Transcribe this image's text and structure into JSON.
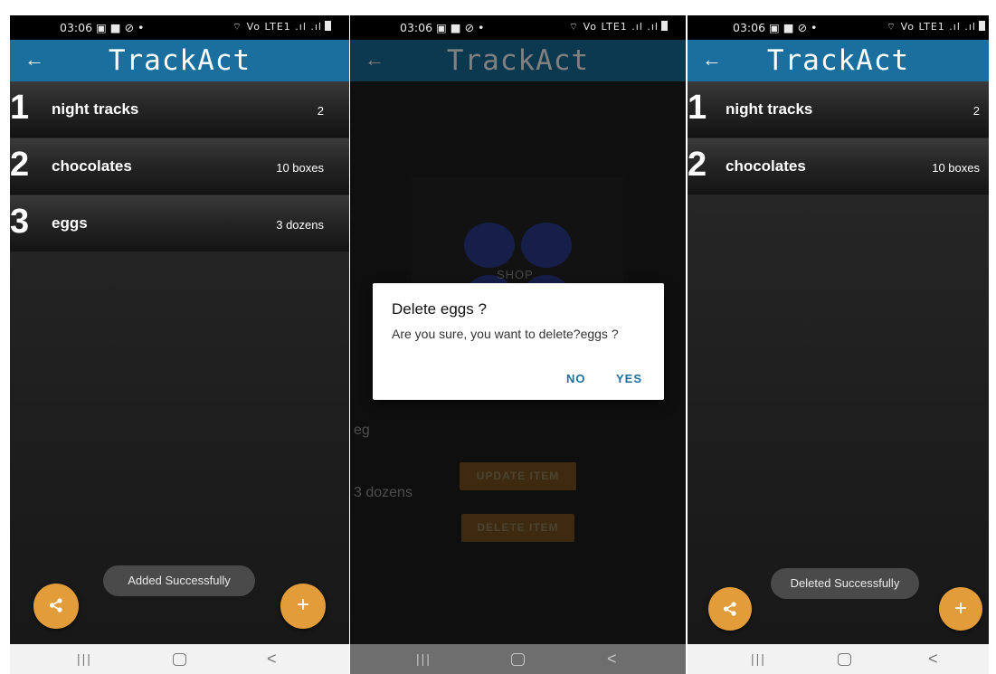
{
  "status": {
    "time": "03:06 ▣ ■ ⊘ •",
    "icons": "⌔ Vo LTE1 .ıl .ıl"
  },
  "app": {
    "title": "TrackAct",
    "back_icon": "arrow-left-icon"
  },
  "screen1": {
    "items": [
      {
        "num": "1",
        "name": "night tracks",
        "qty": "2"
      },
      {
        "num": "2",
        "name": "chocolates",
        "qty": "10 boxes"
      },
      {
        "num": "3",
        "name": "eggs",
        "qty": "3 dozens"
      }
    ],
    "toast": "Added Successfully",
    "share_icon": "share-icon",
    "add_label": "+"
  },
  "screen2": {
    "shop_text": "SHOP",
    "detail_name": "eg",
    "detail_qty": "3 dozens",
    "update_label": "UPDATE ITEM",
    "delete_label": "DELETE ITEM",
    "dialog": {
      "title": "Delete eggs ?",
      "message": "Are you sure, you want to delete?eggs ?",
      "no": "NO",
      "yes": "YES"
    }
  },
  "screen3": {
    "items": [
      {
        "num": "1",
        "name": "night tracks",
        "qty": "2"
      },
      {
        "num": "2",
        "name": "chocolates",
        "qty": "10 boxes"
      }
    ],
    "toast": "Deleted Successfully",
    "add_label": "+"
  },
  "navbar": {
    "recent": "|||",
    "back": "<"
  },
  "colors": {
    "appbar": "#1a6f9e",
    "fab": "#e29d3a",
    "shop_circle": "#2a3e94",
    "dialog_button": "#1a6f9e"
  }
}
